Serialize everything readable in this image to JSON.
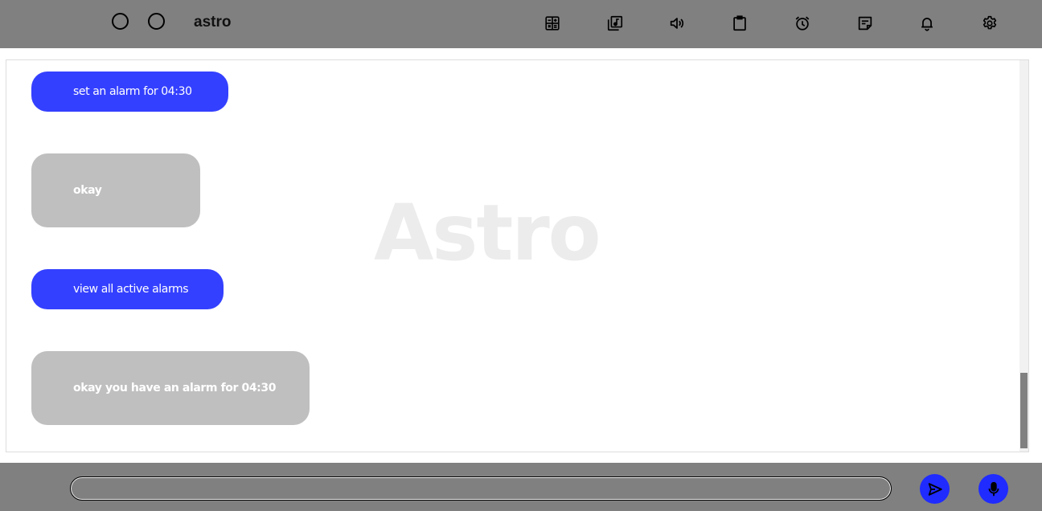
{
  "header": {
    "app_title": "astro",
    "icons": [
      "calculator-icon",
      "music-library-icon",
      "volume-icon",
      "clipboard-icon",
      "alarm-icon",
      "notes-icon",
      "bell-icon",
      "settings-icon"
    ]
  },
  "chat": {
    "watermark": "Astro",
    "messages": [
      {
        "sender": "user",
        "text": "set an alarm for 04:30"
      },
      {
        "sender": "bot",
        "text": "okay"
      },
      {
        "sender": "user",
        "text": "view all active alarms"
      },
      {
        "sender": "bot",
        "text": "okay you have an alarm for 04:30"
      }
    ]
  },
  "composer": {
    "input_value": "",
    "placeholder": ""
  },
  "colors": {
    "bar": "#808080",
    "user_bubble": "#3440ff",
    "bot_bubble": "#bfbfbf",
    "action_button": "#1f2bff"
  }
}
